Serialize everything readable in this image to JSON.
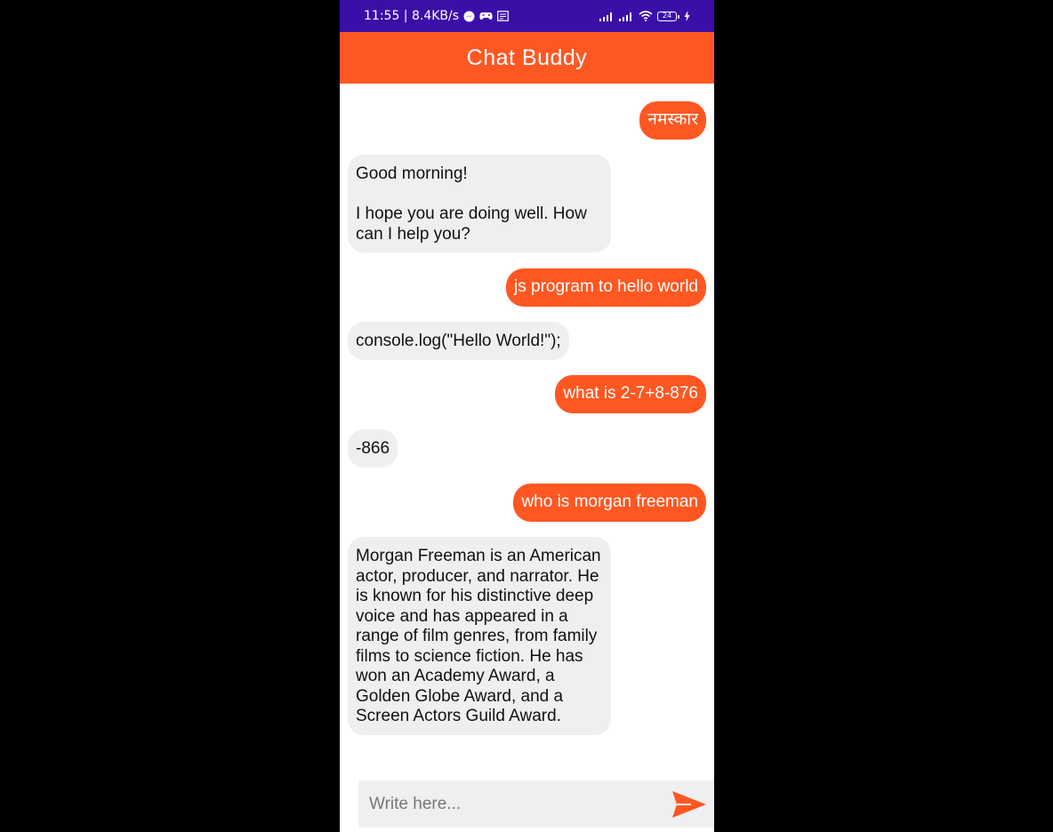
{
  "status_bar": {
    "time_speed": "11:55 | 8.4KB/s",
    "battery": "24",
    "icons": [
      "messenger-icon",
      "gamepad-icon",
      "news-icon",
      "signal-icon",
      "signal-icon",
      "wifi-icon",
      "battery-icon",
      "charging-icon"
    ]
  },
  "header": {
    "title": "Chat Buddy"
  },
  "colors": {
    "accent": "#ff5722",
    "status_bar": "#3a0fa8",
    "bot_bubble": "#eeeff1"
  },
  "messages": [
    {
      "sender": "user",
      "text": "नमस्कार"
    },
    {
      "sender": "bot",
      "text": "Good morning!\n\nI hope you are doing well. How can I help you?"
    },
    {
      "sender": "user",
      "text": "js program to hello world"
    },
    {
      "sender": "bot",
      "text": "console.log(\"Hello World!\");"
    },
    {
      "sender": "user",
      "text": "what is 2-7+8-876"
    },
    {
      "sender": "bot",
      "text": "-866"
    },
    {
      "sender": "user",
      "text": "who is morgan freeman"
    },
    {
      "sender": "bot",
      "text": "Morgan Freeman is an American actor, producer, and narrator. He is known for his distinctive deep voice and has appeared in a range of film genres, from family films to science fiction. He has won an Academy Award, a Golden Globe Award, and a Screen Actors Guild Award."
    }
  ],
  "input": {
    "placeholder": "Write here...",
    "value": ""
  }
}
